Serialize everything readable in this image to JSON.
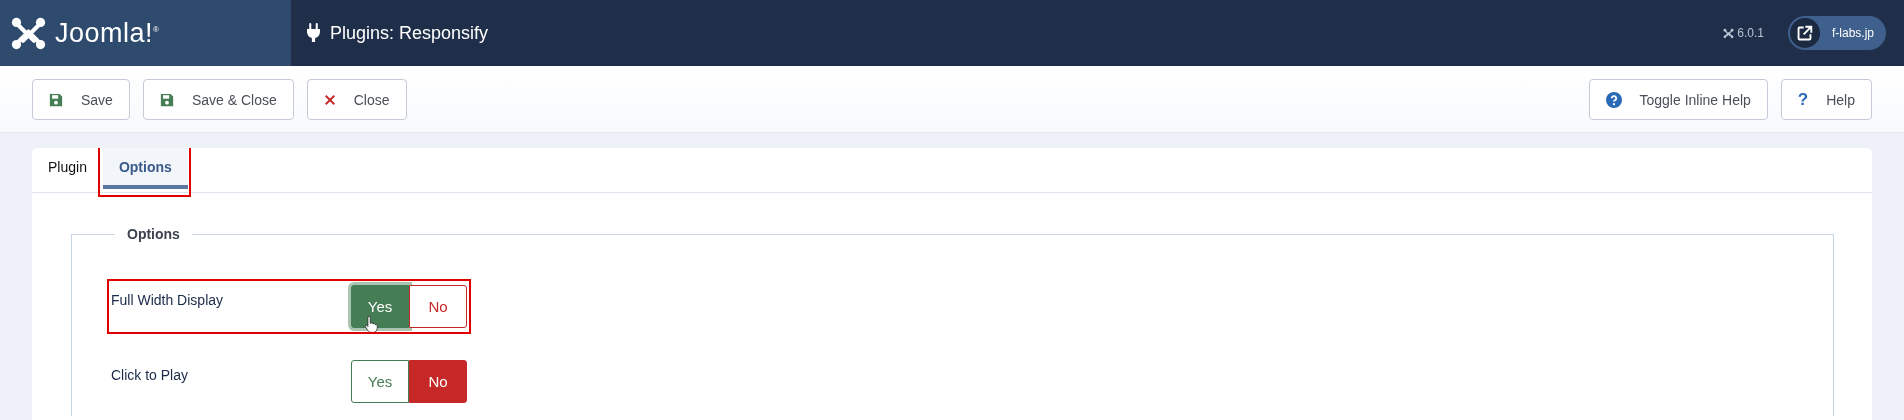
{
  "header": {
    "logo": "Joomla!$^{®}$",
    "title": "Plugins: Responsify",
    "version": "6.0.1",
    "site_link": "f-labs.jp"
  },
  "toolbar": {
    "buttons": [
      {
        "label": "Save",
        "kind": "save"
      },
      {
        "label": "Save & Close",
        "kind": "save"
      },
      {
        "label": "Close",
        "kind": "close"
      }
    ],
    "right_buttons": [
      {
        "label": "Toggle Inline Help",
        "kind": "inline-help"
      },
      {
        "label": "Help",
        "kind": "help",
        "icon_text": "?"
      }
    ]
  },
  "tabs": [
    {
      "label": "Plugin",
      "selected": false,
      "highlighted": false
    },
    {
      "label": "Options",
      "selected": true,
      "highlighted": true
    }
  ],
  "fieldset": {
    "legend": "Options",
    "fields": [
      {
        "label": "Full Width Display",
        "highlighted": true,
        "hovered": true,
        "options": [
          {
            "label": "Yes",
            "selected": true
          },
          {
            "label": "No",
            "selected": false
          }
        ]
      },
      {
        "label": "Click to Play",
        "highlighted": false,
        "hovered": false,
        "options": [
          {
            "label": "Yes",
            "selected": false
          },
          {
            "label": "No",
            "selected": true
          }
        ]
      }
    ]
  }
}
